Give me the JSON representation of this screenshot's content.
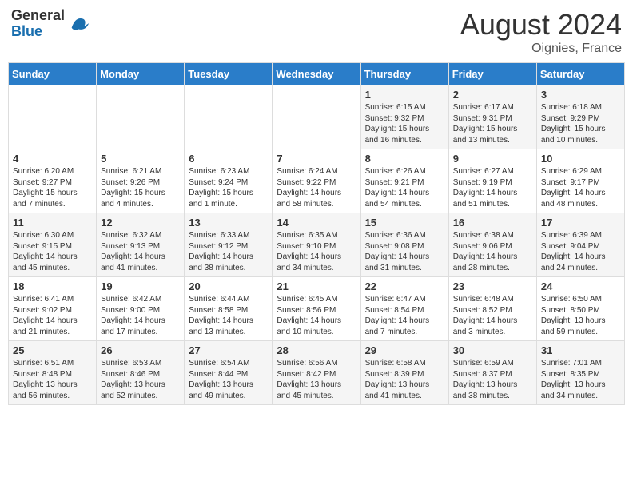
{
  "logo": {
    "general": "General",
    "blue": "Blue"
  },
  "header": {
    "month_year": "August 2024",
    "location": "Oignies, France"
  },
  "weekdays": [
    "Sunday",
    "Monday",
    "Tuesday",
    "Wednesday",
    "Thursday",
    "Friday",
    "Saturday"
  ],
  "weeks": [
    [
      {
        "day": "",
        "info": ""
      },
      {
        "day": "",
        "info": ""
      },
      {
        "day": "",
        "info": ""
      },
      {
        "day": "",
        "info": ""
      },
      {
        "day": "1",
        "info": "Sunrise: 6:15 AM\nSunset: 9:32 PM\nDaylight: 15 hours\nand 16 minutes."
      },
      {
        "day": "2",
        "info": "Sunrise: 6:17 AM\nSunset: 9:31 PM\nDaylight: 15 hours\nand 13 minutes."
      },
      {
        "day": "3",
        "info": "Sunrise: 6:18 AM\nSunset: 9:29 PM\nDaylight: 15 hours\nand 10 minutes."
      }
    ],
    [
      {
        "day": "4",
        "info": "Sunrise: 6:20 AM\nSunset: 9:27 PM\nDaylight: 15 hours\nand 7 minutes."
      },
      {
        "day": "5",
        "info": "Sunrise: 6:21 AM\nSunset: 9:26 PM\nDaylight: 15 hours\nand 4 minutes."
      },
      {
        "day": "6",
        "info": "Sunrise: 6:23 AM\nSunset: 9:24 PM\nDaylight: 15 hours\nand 1 minute."
      },
      {
        "day": "7",
        "info": "Sunrise: 6:24 AM\nSunset: 9:22 PM\nDaylight: 14 hours\nand 58 minutes."
      },
      {
        "day": "8",
        "info": "Sunrise: 6:26 AM\nSunset: 9:21 PM\nDaylight: 14 hours\nand 54 minutes."
      },
      {
        "day": "9",
        "info": "Sunrise: 6:27 AM\nSunset: 9:19 PM\nDaylight: 14 hours\nand 51 minutes."
      },
      {
        "day": "10",
        "info": "Sunrise: 6:29 AM\nSunset: 9:17 PM\nDaylight: 14 hours\nand 48 minutes."
      }
    ],
    [
      {
        "day": "11",
        "info": "Sunrise: 6:30 AM\nSunset: 9:15 PM\nDaylight: 14 hours\nand 45 minutes."
      },
      {
        "day": "12",
        "info": "Sunrise: 6:32 AM\nSunset: 9:13 PM\nDaylight: 14 hours\nand 41 minutes."
      },
      {
        "day": "13",
        "info": "Sunrise: 6:33 AM\nSunset: 9:12 PM\nDaylight: 14 hours\nand 38 minutes."
      },
      {
        "day": "14",
        "info": "Sunrise: 6:35 AM\nSunset: 9:10 PM\nDaylight: 14 hours\nand 34 minutes."
      },
      {
        "day": "15",
        "info": "Sunrise: 6:36 AM\nSunset: 9:08 PM\nDaylight: 14 hours\nand 31 minutes."
      },
      {
        "day": "16",
        "info": "Sunrise: 6:38 AM\nSunset: 9:06 PM\nDaylight: 14 hours\nand 28 minutes."
      },
      {
        "day": "17",
        "info": "Sunrise: 6:39 AM\nSunset: 9:04 PM\nDaylight: 14 hours\nand 24 minutes."
      }
    ],
    [
      {
        "day": "18",
        "info": "Sunrise: 6:41 AM\nSunset: 9:02 PM\nDaylight: 14 hours\nand 21 minutes."
      },
      {
        "day": "19",
        "info": "Sunrise: 6:42 AM\nSunset: 9:00 PM\nDaylight: 14 hours\nand 17 minutes."
      },
      {
        "day": "20",
        "info": "Sunrise: 6:44 AM\nSunset: 8:58 PM\nDaylight: 14 hours\nand 13 minutes."
      },
      {
        "day": "21",
        "info": "Sunrise: 6:45 AM\nSunset: 8:56 PM\nDaylight: 14 hours\nand 10 minutes."
      },
      {
        "day": "22",
        "info": "Sunrise: 6:47 AM\nSunset: 8:54 PM\nDaylight: 14 hours\nand 7 minutes."
      },
      {
        "day": "23",
        "info": "Sunrise: 6:48 AM\nSunset: 8:52 PM\nDaylight: 14 hours\nand 3 minutes."
      },
      {
        "day": "24",
        "info": "Sunrise: 6:50 AM\nSunset: 8:50 PM\nDaylight: 13 hours\nand 59 minutes."
      }
    ],
    [
      {
        "day": "25",
        "info": "Sunrise: 6:51 AM\nSunset: 8:48 PM\nDaylight: 13 hours\nand 56 minutes."
      },
      {
        "day": "26",
        "info": "Sunrise: 6:53 AM\nSunset: 8:46 PM\nDaylight: 13 hours\nand 52 minutes."
      },
      {
        "day": "27",
        "info": "Sunrise: 6:54 AM\nSunset: 8:44 PM\nDaylight: 13 hours\nand 49 minutes."
      },
      {
        "day": "28",
        "info": "Sunrise: 6:56 AM\nSunset: 8:42 PM\nDaylight: 13 hours\nand 45 minutes."
      },
      {
        "day": "29",
        "info": "Sunrise: 6:58 AM\nSunset: 8:39 PM\nDaylight: 13 hours\nand 41 minutes."
      },
      {
        "day": "30",
        "info": "Sunrise: 6:59 AM\nSunset: 8:37 PM\nDaylight: 13 hours\nand 38 minutes."
      },
      {
        "day": "31",
        "info": "Sunrise: 7:01 AM\nSunset: 8:35 PM\nDaylight: 13 hours\nand 34 minutes."
      }
    ]
  ]
}
